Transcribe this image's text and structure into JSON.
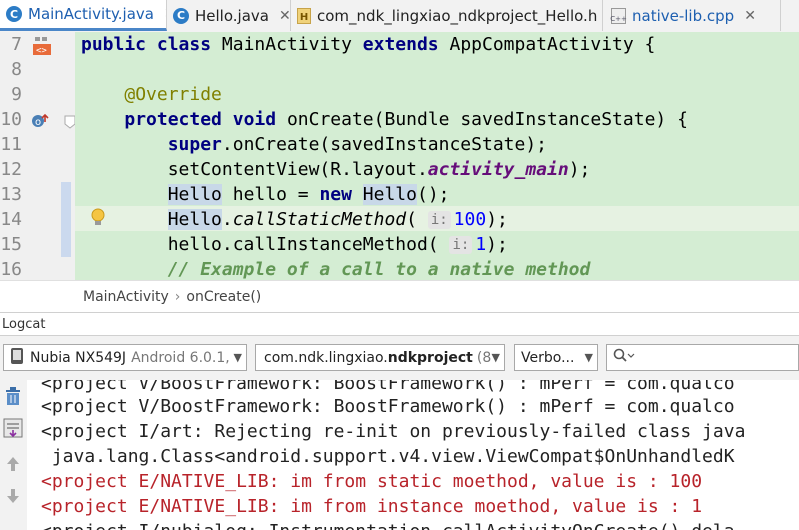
{
  "tabs": [
    {
      "label": "MainActivity.java",
      "icon": "c-class-icon",
      "active": true
    },
    {
      "label": "Hello.java",
      "icon": "c-class-icon",
      "active": false
    },
    {
      "label": "com_ndk_lingxiao_ndkproject_Hello.h",
      "icon": "h-file-icon",
      "active": false
    },
    {
      "label": "native-lib.cpp",
      "icon": "cpp-file-icon",
      "active": false
    }
  ],
  "editor": {
    "line_numbers": [
      "7",
      "8",
      "9",
      "10",
      "11",
      "12",
      "13",
      "14",
      "15",
      "16"
    ],
    "lines": {
      "l7": {
        "kw1": "public",
        "kw2": "class",
        "t1": " MainActivity ",
        "kw3": "extends",
        "t2": " AppCompatActivity {"
      },
      "l9": {
        "annotation": "@Override"
      },
      "l10": {
        "kw1": "protected",
        "kw2": "void",
        "t1": " onCreate(Bundle savedInstanceState) {"
      },
      "l11": {
        "kw1": "super",
        "t1": ".onCreate(savedInstanceState);"
      },
      "l12": {
        "t1": "setContentView(R.layout.",
        "field": "activity_main",
        "t2": ");"
      },
      "l13": {
        "t1": "Hello",
        "t2": " hello = ",
        "kw1": "new",
        "t3": " ",
        "t4": "Hello",
        "t5": "();"
      },
      "l14": {
        "t1": "Hello",
        "t2": ".",
        "method": "callStaticMethod",
        "t3": "( ",
        "hint": "i:",
        "num": "100",
        "t4": ");"
      },
      "l15": {
        "t1": "hello.callInstanceMethod( ",
        "hint": "i:",
        "num": "1",
        "t2": ");"
      },
      "l16": {
        "comment": "// Example of a call to a native method"
      }
    }
  },
  "breadcrumb": {
    "items": [
      "MainActivity",
      "onCreate()"
    ],
    "separator": "›"
  },
  "logcat": {
    "title": "Logcat",
    "device": {
      "name": "Nubia NX549J",
      "detail": "Android 6.0.1,"
    },
    "process": {
      "name_prefix": "com.ndk.lingxiao.",
      "name_bold": "ndkproject",
      "detail": "(8"
    },
    "level": "Verbo...",
    "search_placeholder": "",
    "lines": [
      {
        "text": "<project V/BoostFramework: BoostFramework() : mPerf = com.qualco",
        "level": "normal"
      },
      {
        "text": "<project V/BoostFramework: BoostFramework() : mPerf = com.qualco",
        "level": "normal"
      },
      {
        "text": "<project I/art: Rejecting re-init on previously-failed class java",
        "level": "normal"
      },
      {
        "text": " java.lang.Class<android.support.v4.view.ViewCompat$OnUnhandledK",
        "level": "normal"
      },
      {
        "text": "<project E/NATIVE_LIB: im from static moethod, value is : 100",
        "level": "error"
      },
      {
        "text": "<project E/NATIVE_LIB: im from instance moethod, value is : 1",
        "level": "error"
      },
      {
        "text": "<project I/nubialog: Instrumentation.callActivityOnCreate() dela",
        "level": "normal"
      }
    ]
  },
  "colors": {
    "accent": "#4a86c8",
    "editor_bg": "#d4edd3",
    "error_text": "#b8232a",
    "keyword": "#000080"
  }
}
